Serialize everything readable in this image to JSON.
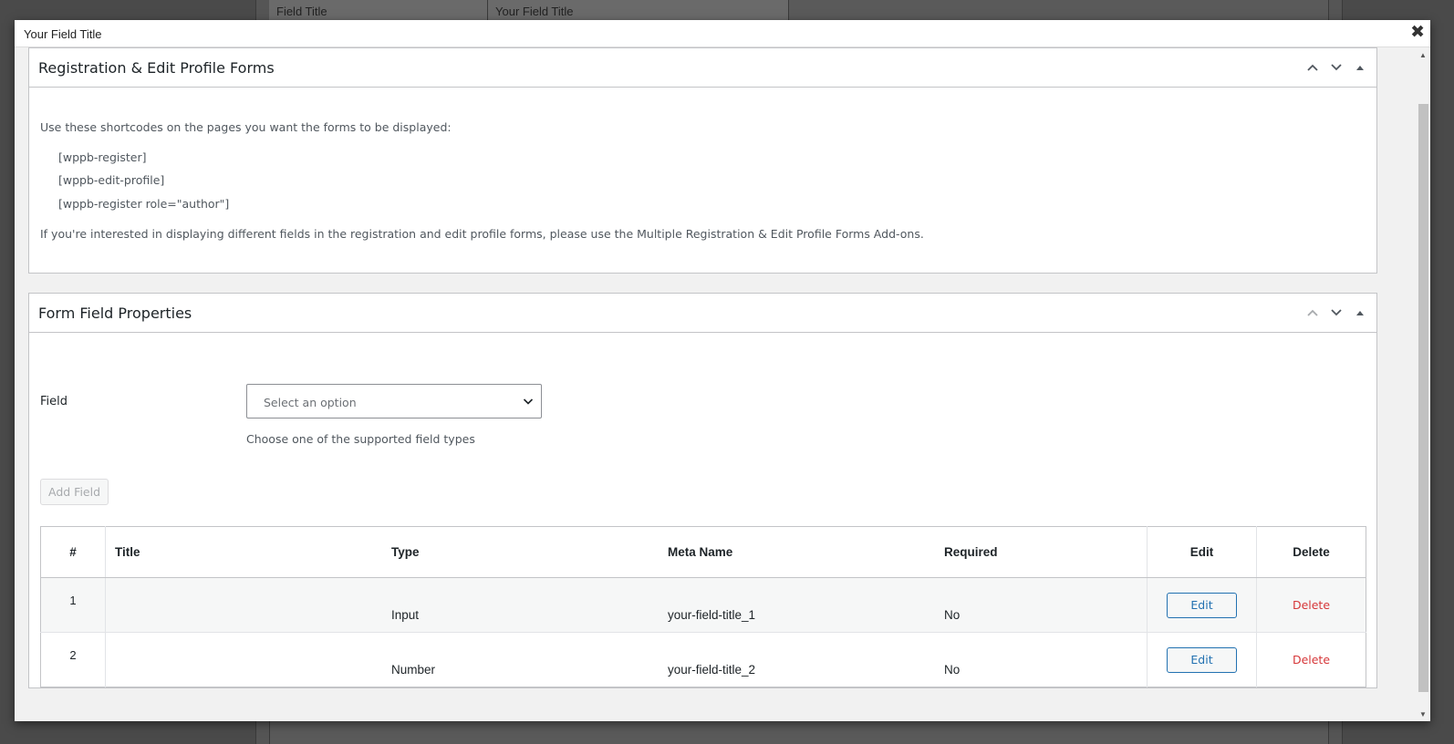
{
  "background": {
    "col1": "Field Title",
    "col2": "Your Field Title"
  },
  "modal": {
    "title": "Your Field Title",
    "close_glyph": "✖"
  },
  "registration_box": {
    "title": "Registration & Edit Profile Forms",
    "intro": "Use these shortcodes on the pages you want the forms to be displayed:",
    "shortcodes": [
      "[wppb-register]",
      "[wppb-edit-profile]",
      "[wppb-register role=\"author\"]"
    ],
    "note": "If you're interested in displaying different fields in the registration and edit profile forms, please use the Multiple Registration & Edit Profile Forms Add-ons."
  },
  "properties_box": {
    "title": "Form Field Properties",
    "field_label": "Field",
    "select_placeholder": "Select an option",
    "help_text": "Choose one of the supported field types",
    "add_button": "Add Field"
  },
  "table": {
    "headers": [
      "#",
      "Title",
      "Type",
      "Meta Name",
      "Required",
      "Edit",
      "Delete"
    ],
    "rows": [
      {
        "num": "1",
        "title": "",
        "type": "Input",
        "meta": "your-field-title_1",
        "required": "No",
        "edit": "Edit",
        "delete": "Delete"
      },
      {
        "num": "2",
        "title": "",
        "type": "Number",
        "meta": "your-field-title_2",
        "required": "No",
        "edit": "Edit",
        "delete": "Delete"
      }
    ]
  },
  "colors": {
    "accent": "#2271b1",
    "danger": "#d63638",
    "overlay": "#4a4a4a"
  }
}
